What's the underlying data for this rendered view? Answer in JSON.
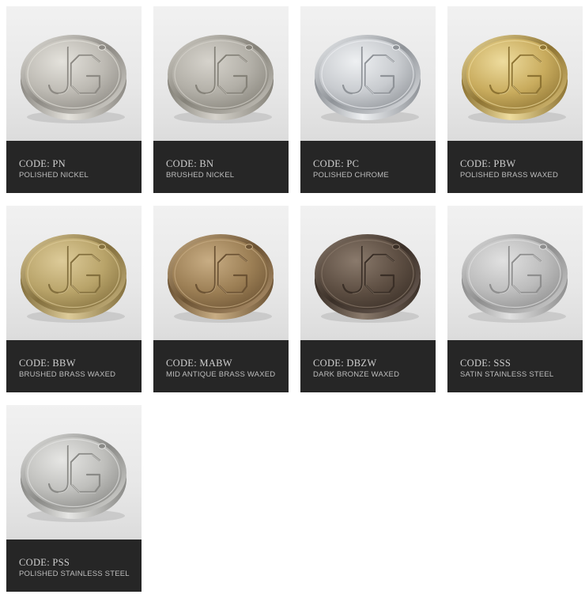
{
  "finishes": [
    {
      "code": "CODE: PN",
      "name": "POLISHED NICKEL",
      "light": "#e4e2dc",
      "mid": "#bdbab3",
      "dark": "#8d8a84",
      "rim": "#d9d7d1"
    },
    {
      "code": "CODE: BN",
      "name": "BRUSHED NICKEL",
      "light": "#d6d3cc",
      "mid": "#b2afa7",
      "dark": "#858279",
      "rim": "#c9c6bf"
    },
    {
      "code": "CODE: PC",
      "name": "POLISHED CHROME",
      "light": "#eef0f2",
      "mid": "#c8cbcf",
      "dark": "#8f9398",
      "rim": "#e3e5e8"
    },
    {
      "code": "CODE: PBW",
      "name": "POLISHED BRASS WAXED",
      "light": "#eedc9e",
      "mid": "#c9ac5e",
      "dark": "#8e7433",
      "rim": "#dcc27a"
    },
    {
      "code": "CODE: BBW",
      "name": "BRUSHED BRASS WAXED",
      "light": "#ddcb99",
      "mid": "#b9a46a",
      "dark": "#84703e",
      "rim": "#cbb782"
    },
    {
      "code": "CODE: MABW",
      "name": "MID ANTIQUE BRASS WAXED",
      "light": "#c8ad84",
      "mid": "#9c7f55",
      "dark": "#6c5334",
      "rim": "#b49670"
    },
    {
      "code": "CODE: DBZW",
      "name": "DARK BRONZE WAXED",
      "light": "#8a7a6c",
      "mid": "#5e4f43",
      "dark": "#3a2f27",
      "rim": "#71625a"
    },
    {
      "code": "CODE: SSS",
      "name": "SATIN STAINLESS STEEL",
      "light": "#e1e1e1",
      "mid": "#bdbdbd",
      "dark": "#8e8e8e",
      "rim": "#d2d2d2"
    },
    {
      "code": "CODE: PSS",
      "name": "POLISHED STAINLESS STEEL",
      "light": "#e6e6e4",
      "mid": "#bfbfbc",
      "dark": "#8a8a87",
      "rim": "#dadad7"
    }
  ]
}
